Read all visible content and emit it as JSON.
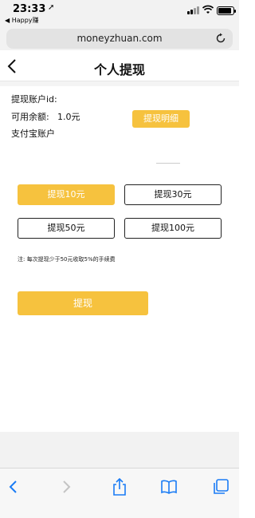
{
  "status_bar": {
    "time": "23:33",
    "back_app_label": "◀ Happy赚"
  },
  "browser": {
    "url": "moneyzhuan.com"
  },
  "header": {
    "title": "个人提现"
  },
  "account": {
    "id_label": "提现账户id:",
    "balance_label": "可用余额:",
    "balance_value": "1.0元",
    "detail_button": "提现明细",
    "alipay_label": "支付宝账户"
  },
  "amounts": [
    {
      "label": "提现10元",
      "selected": true
    },
    {
      "label": "提现30元",
      "selected": false
    },
    {
      "label": "提现50元",
      "selected": false
    },
    {
      "label": "提现100元",
      "selected": false
    }
  ],
  "note": "注: 每次提现少于50元收取5%的手续费",
  "withdraw_button": "提现",
  "colors": {
    "accent": "#f6c23e",
    "ios_blue": "#1a7cf5"
  },
  "toolbar": {
    "icons": [
      "back-icon",
      "forward-icon",
      "share-icon",
      "bookmarks-icon",
      "tabs-icon"
    ]
  }
}
